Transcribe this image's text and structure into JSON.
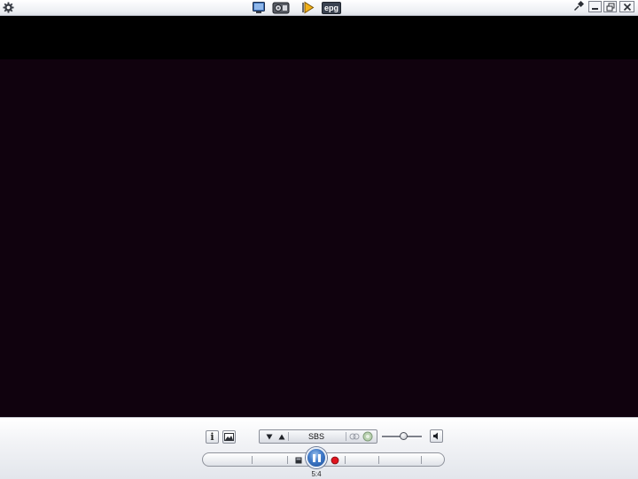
{
  "titlebar": {
    "icons": {
      "settings": "gear-icon",
      "tv_mode": "tv-monitor-icon",
      "radio_mode": "radio-icon",
      "media_mode": "play-triangle-icon",
      "epg_mode": "epg-icon",
      "pin": "pin-icon",
      "minimize": "minimize-icon",
      "maximize": "restore-icon",
      "close": "close-icon"
    },
    "epg_label": "epg"
  },
  "controls": {
    "channel": {
      "name": "SBS"
    },
    "volume": {
      "level": 0.55
    },
    "bottom_caption": "5:4",
    "colors": {
      "record": "#e0141e",
      "pause_accent": "#3f79c7",
      "video_background": "#10020e"
    }
  }
}
